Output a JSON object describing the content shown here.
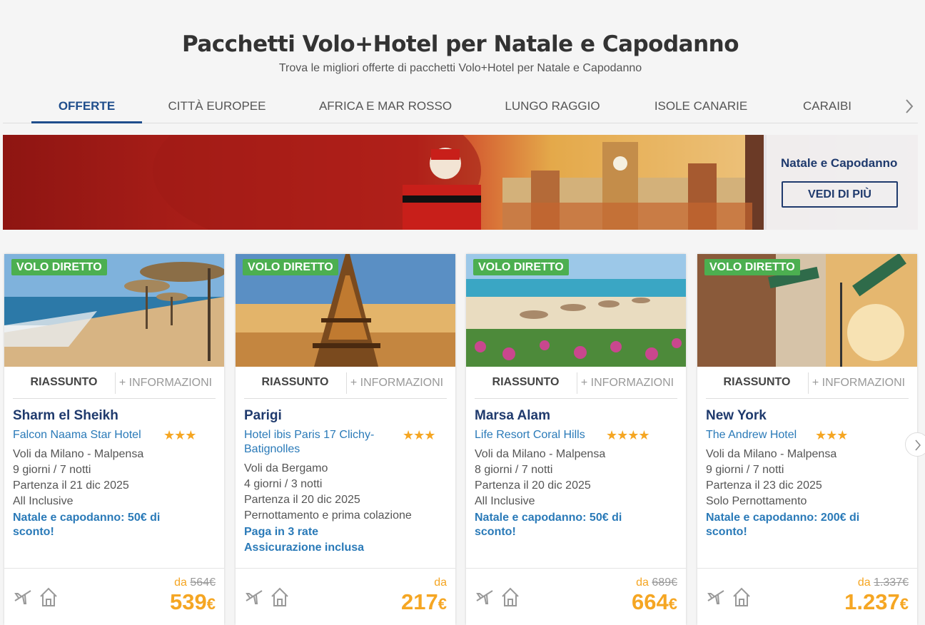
{
  "page": {
    "title": "Pacchetti Volo+Hotel per Natale e Capodanno",
    "subtitle": "Trova le migliori offerte di pacchetti Volo+Hotel per Natale e Capodanno"
  },
  "tabs": [
    {
      "label": "OFFERTE",
      "active": true
    },
    {
      "label": "CITTÀ EUROPEE"
    },
    {
      "label": "AFRICA E MAR ROSSO"
    },
    {
      "label": "LUNGO RAGGIO"
    },
    {
      "label": "ISOLE CANARIE"
    },
    {
      "label": "CARAIBI"
    }
  ],
  "banner": {
    "title": "Natale e Capodanno",
    "button": "VEDI DI PIÙ"
  },
  "cards": [
    {
      "badge": "VOLO DIRETTO",
      "tab1": "RIASSUNTO",
      "tab2": "+ INFORMAZIONI",
      "destination": "Sharm el Sheikh",
      "hotel": "Falcon Naama Star Hotel",
      "stars": "★★★",
      "lines": [
        "Voli da Milano - Malpensa",
        "9 giorni / 7 notti",
        "Partenza il 21 dic 2025",
        "All Inclusive"
      ],
      "promo": [
        "Natale e capodanno: 50€ di sconto!"
      ],
      "from": "da",
      "old_price": "564€",
      "price": "539",
      "currency": "€"
    },
    {
      "badge": "VOLO DIRETTO",
      "tab1": "RIASSUNTO",
      "tab2": "+ INFORMAZIONI",
      "destination": "Parigi",
      "hotel": "Hotel ibis Paris 17 Clichy-Batignolles",
      "stars": "★★★",
      "lines": [
        "Voli da Bergamo",
        "4 giorni / 3 notti",
        "Partenza il 20 dic 2025",
        "Pernottamento e prima colazione"
      ],
      "promo": [
        "Paga in 3 rate",
        "Assicurazione inclusa"
      ],
      "from": "da",
      "old_price": "",
      "price": "217",
      "currency": "€"
    },
    {
      "badge": "VOLO DIRETTO",
      "tab1": "RIASSUNTO",
      "tab2": "+ INFORMAZIONI",
      "destination": "Marsa Alam",
      "hotel": "Life Resort Coral Hills",
      "stars": "★★★★",
      "lines": [
        "Voli da Milano - Malpensa",
        "8 giorni / 7 notti",
        "Partenza il 20 dic 2025",
        "All Inclusive"
      ],
      "promo": [
        "Natale e capodanno: 50€ di sconto!"
      ],
      "from": "da",
      "old_price": "689€",
      "price": "664",
      "currency": "€"
    },
    {
      "badge": "VOLO DIRETTO",
      "tab1": "RIASSUNTO",
      "tab2": "+ INFORMAZIONI",
      "destination": "New York",
      "hotel": "The Andrew Hotel",
      "stars": "★★★",
      "lines": [
        "Voli da Milano - Malpensa",
        "9 giorni / 7 notti",
        "Partenza il 23 dic 2025",
        "Solo Pernottamento"
      ],
      "promo": [
        "Natale e capodanno: 200€ di sconto!"
      ],
      "from": "da",
      "old_price": "1.337€",
      "price": "1.237",
      "currency": "€"
    }
  ],
  "colors": {
    "brand_blue": "#1f3a6d",
    "link_blue": "#2a7ab8",
    "price_orange": "#f5a623",
    "badge_green": "#4caf50"
  }
}
